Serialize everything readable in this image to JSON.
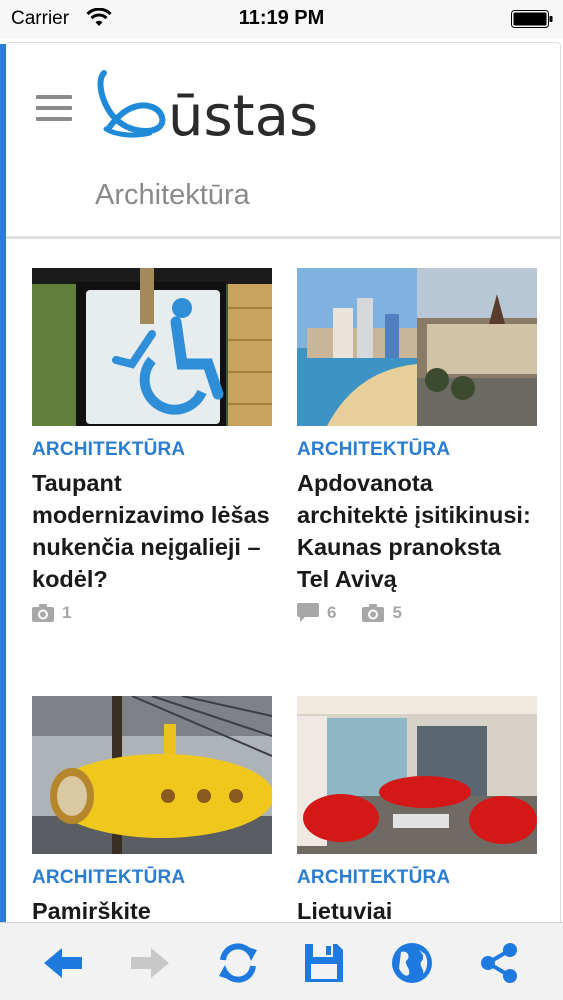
{
  "status_bar": {
    "carrier": "Carrier",
    "time": "11:19 PM"
  },
  "header": {
    "logo_text": "ūstas",
    "section_title": "Architektūra"
  },
  "articles": [
    {
      "category": "ARCHITEKTŪRA",
      "title": "Taupant modernizavimo lėšas nukenčia neįgalieji – kodėl?",
      "photos": "1"
    },
    {
      "category": "ARCHITEKTŪRA",
      "title": "Apdovanota architektė įsitikinusi: Kaunas pranoksta Tel Avivą",
      "comments": "6",
      "photos": "5"
    },
    {
      "category": "ARCHITEKTŪRA",
      "title": "Pamirškite"
    },
    {
      "category": "ARCHITEKTŪRA",
      "title": "Lietuviai"
    }
  ],
  "colors": {
    "accent": "#2a7dd0",
    "meta": "#a7a7a7",
    "toolbar_icon": "#1f7ae0",
    "toolbar_disabled": "#c8c8c8"
  },
  "toolbar": {
    "icons": [
      "arrow-left-icon",
      "arrow-right-icon",
      "refresh-icon",
      "save-icon",
      "globe-icon",
      "share-icon"
    ]
  }
}
